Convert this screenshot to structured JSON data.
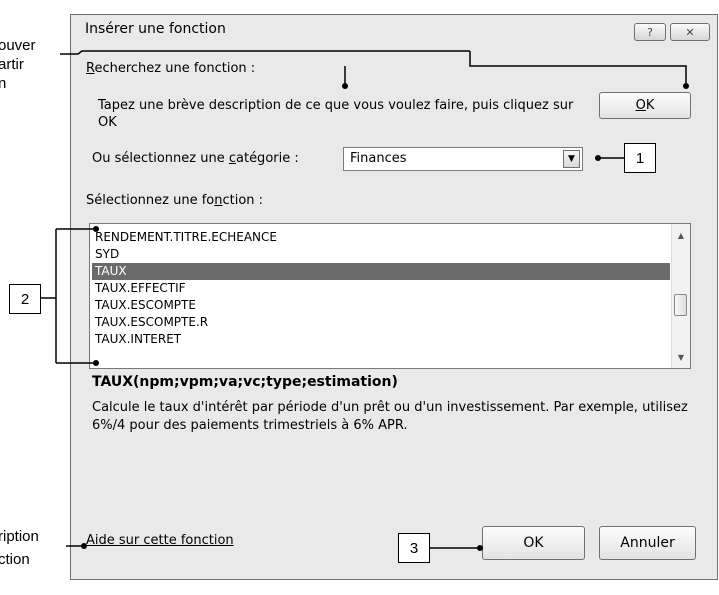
{
  "external_text": {
    "left_top": [
      "ouver",
      "artir",
      "n"
    ],
    "left_bottom": [
      "ription",
      "ction"
    ]
  },
  "dialog": {
    "title": "Insérer une fonction",
    "help_button": "?",
    "close_button": "✕",
    "search_label_accel": "R",
    "search_label_rest": "echerchez une fonction :",
    "search_text": "Tapez une brève description de ce que vous voulez faire, puis cliquez sur OK",
    "search_ok_accel": "O",
    "search_ok_rest": "K",
    "category_label_pre": "Ou sélectionnez une ",
    "category_label_accel": "c",
    "category_label_post": "atégorie :",
    "category_value": "Finances",
    "function_label_pre": "Sélectionnez une fo",
    "function_label_accel": "n",
    "function_label_post": "ction :",
    "functions": [
      "RENDEMENT.TITRE.ECHEANCE",
      "SYD",
      "TAUX",
      "TAUX.EFFECTIF",
      "TAUX.ESCOMPTE",
      "TAUX.ESCOMPTE.R",
      "TAUX.INTERET"
    ],
    "selected_function": "TAUX",
    "syntax": "TAUX(npm;vpm;va;vc;type;estimation)",
    "description": "Calcule le taux d'intérêt par période d'un prêt ou d'un investissement. Par exemple, utilisez 6%/4 pour des paiements trimestriels à 6% APR.",
    "help_link": "Aide sur cette fonction",
    "ok_button": "OK",
    "cancel_button": "Annuler"
  },
  "callouts": [
    "1",
    "2",
    "3"
  ]
}
